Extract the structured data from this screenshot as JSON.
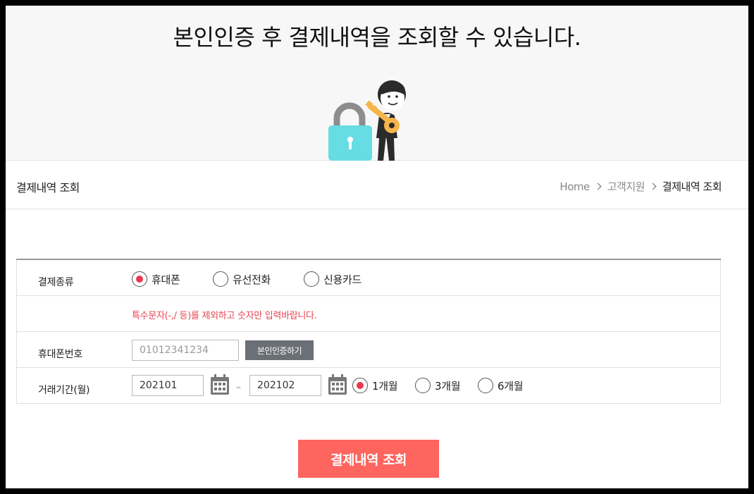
{
  "hero": {
    "title": "본인인증 후 결제내역을 조회할 수 있습니다."
  },
  "header": {
    "page_title": "결제내역 조회",
    "breadcrumb": [
      "Home",
      "고객지원",
      "결제내역 조회"
    ]
  },
  "form": {
    "payment_type": {
      "label": "결제종류",
      "options": [
        {
          "label": "휴대폰",
          "checked": true
        },
        {
          "label": "유선전화",
          "checked": false
        },
        {
          "label": "신용카드",
          "checked": false
        }
      ]
    },
    "notice": "특수문자(-,/ 등)를 제외하고 숫자만 입력바랍니다.",
    "phone": {
      "label": "휴대폰번호",
      "placeholder": "01012341234",
      "verify_button": "본인인증하기"
    },
    "period": {
      "label": "거래기간(월)",
      "start": "202101",
      "separator": "–",
      "end": "202102",
      "options": [
        {
          "label": "1개월",
          "checked": true
        },
        {
          "label": "3개월",
          "checked": false
        },
        {
          "label": "6개월",
          "checked": false
        }
      ]
    }
  },
  "submit_label": "결제내역 조회",
  "colors": {
    "accent": "#fd655e",
    "radio_checked": "#e8384f",
    "notice": "#e8434f",
    "verify_button": "#6b6f76",
    "lock": "#65dde3",
    "key": "#f5b54b"
  }
}
